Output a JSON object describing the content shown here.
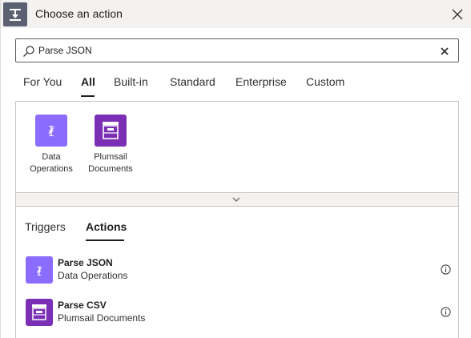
{
  "window": {
    "title": "Choose an action",
    "header_icon": "flow-step-icon",
    "close_icon": "close-icon"
  },
  "search": {
    "value": "Parse JSON",
    "placeholder": "Search connectors and actions",
    "icon": "search-icon",
    "clear_icon": "clear-icon"
  },
  "category_tabs": [
    {
      "label": "For You",
      "active": false
    },
    {
      "label": "All",
      "active": true
    },
    {
      "label": "Built-in",
      "active": false
    },
    {
      "label": "Standard",
      "active": false
    },
    {
      "label": "Enterprise",
      "active": false
    },
    {
      "label": "Custom",
      "active": false
    }
  ],
  "connectors": [
    {
      "line1": "Data",
      "line2": "Operations",
      "icon": "data-operations-icon",
      "color": "#8c6cff"
    },
    {
      "line1": "Plumsail",
      "line2": "Documents",
      "icon": "plumsail-documents-icon",
      "color": "#7a2fb5"
    }
  ],
  "expander_icon": "chevron-down-icon",
  "result_tabs": [
    {
      "label": "Triggers",
      "active": false
    },
    {
      "label": "Actions",
      "active": true
    }
  ],
  "actions": [
    {
      "name": "Parse JSON",
      "connector": "Data Operations",
      "icon": "data-operations-icon",
      "color": "#8c6cff"
    },
    {
      "name": "Parse CSV",
      "connector": "Plumsail Documents",
      "icon": "plumsail-documents-icon",
      "color": "#7a2fb5"
    }
  ],
  "colors": {
    "accent": "#201f1e",
    "header_bg": "#f3f2f1",
    "data_operations": "#8c6cff",
    "plumsail": "#7a2fb5"
  }
}
